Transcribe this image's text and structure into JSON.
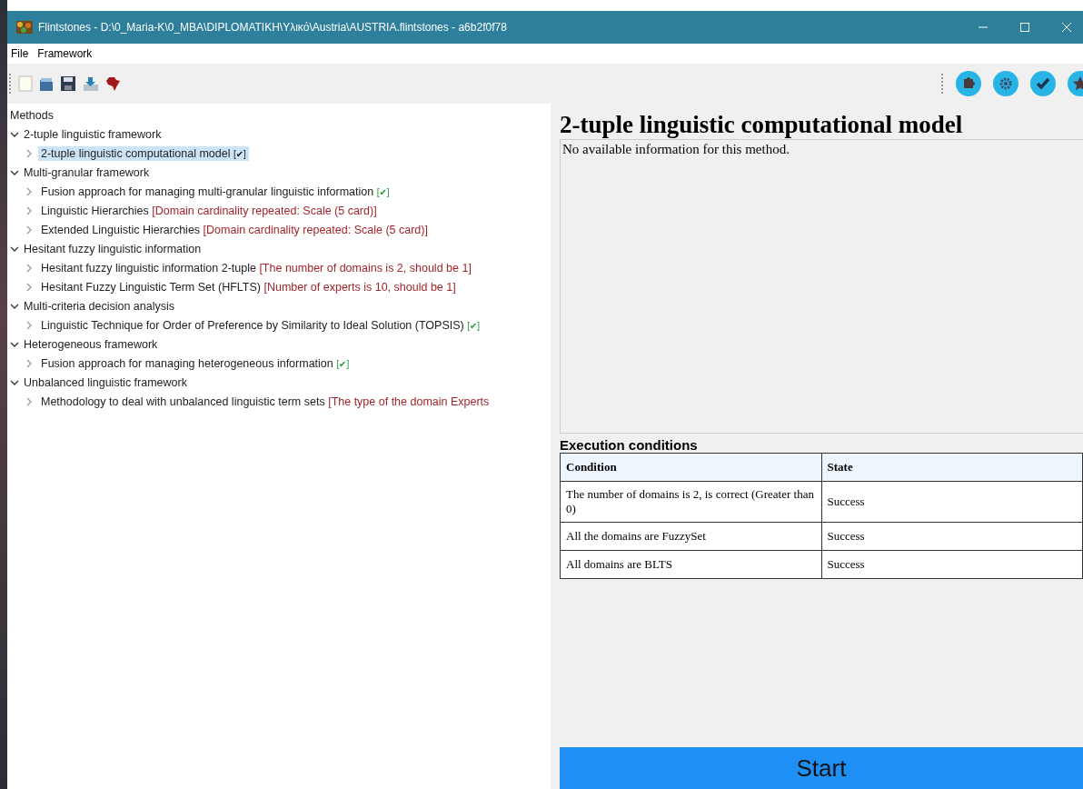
{
  "window": {
    "title": "Flintstones - D:\\0_Maria-K\\0_MBA\\DIPLOMATIKH\\Υλικό\\Austria\\AUSTRIA.flintstones - a6b2f0f78"
  },
  "menu": [
    "File",
    "Framework"
  ],
  "methods": {
    "title": "Methods",
    "groups": [
      {
        "label": "2-tuple linguistic framework",
        "expanded": true,
        "children": [
          {
            "label": "2-tuple linguistic computational model",
            "note": "[✔]",
            "kind": "ok",
            "expanded": false,
            "selected": true
          }
        ]
      },
      {
        "label": "Multi-granular framework",
        "expanded": true,
        "children": [
          {
            "label": "Fusion approach for managing multi-granular linguistic information",
            "note": "[✔]",
            "kind": "ok",
            "expanded": false,
            "selected": false
          },
          {
            "label": "Linguistic Hierarchies",
            "note": "[Domain cardinality repeated: Scale (5 card)]",
            "kind": "error",
            "expanded": false,
            "selected": false
          },
          {
            "label": "Extended Linguistic Hierarchies",
            "note": "[Domain cardinality repeated: Scale (5 card)]",
            "kind": "error",
            "expanded": false,
            "selected": false
          }
        ]
      },
      {
        "label": "Hesitant fuzzy linguistic information",
        "expanded": true,
        "children": [
          {
            "label": "Hesitant fuzzy linguistic information 2-tuple",
            "note": "[The number of domains is 2, should be 1]",
            "kind": "error",
            "expanded": false,
            "selected": false
          },
          {
            "label": "Hesitant Fuzzy Linguistic Term Set (HFLTS)",
            "note": "[Number of experts is 10, should be 1]",
            "kind": "error",
            "expanded": false,
            "selected": false
          }
        ]
      },
      {
        "label": "Multi-criteria decision analysis",
        "expanded": true,
        "children": [
          {
            "label": "Linguistic Technique for Order of Preference by Similarity to Ideal Solution (TOPSIS)",
            "note": "[✔]",
            "kind": "ok",
            "expanded": false,
            "selected": false
          }
        ]
      },
      {
        "label": "Heterogeneous framework",
        "expanded": true,
        "children": [
          {
            "label": "Fusion approach for managing heterogeneous information",
            "note": "[✔]",
            "kind": "ok",
            "expanded": false,
            "selected": false
          }
        ]
      },
      {
        "label": "Unbalanced linguistic framework",
        "expanded": true,
        "children": [
          {
            "label": "Methodology to deal with unbalanced linguistic term sets",
            "note": "[The type of the domain Experts",
            "kind": "error",
            "expanded": false,
            "selected": false
          }
        ]
      }
    ]
  },
  "detail": {
    "title": "2-tuple linguistic computational model",
    "description": "No available information for this method.",
    "conditions_title": "Execution conditions",
    "columns": [
      "Condition",
      "State"
    ],
    "rows": [
      [
        "The number of domains is 2, is correct (Greater than 0)",
        "Success"
      ],
      [
        "All the domains are FuzzySet",
        "Success"
      ],
      [
        "All domains are BLTS",
        "Success"
      ]
    ]
  },
  "start_button": "Start"
}
